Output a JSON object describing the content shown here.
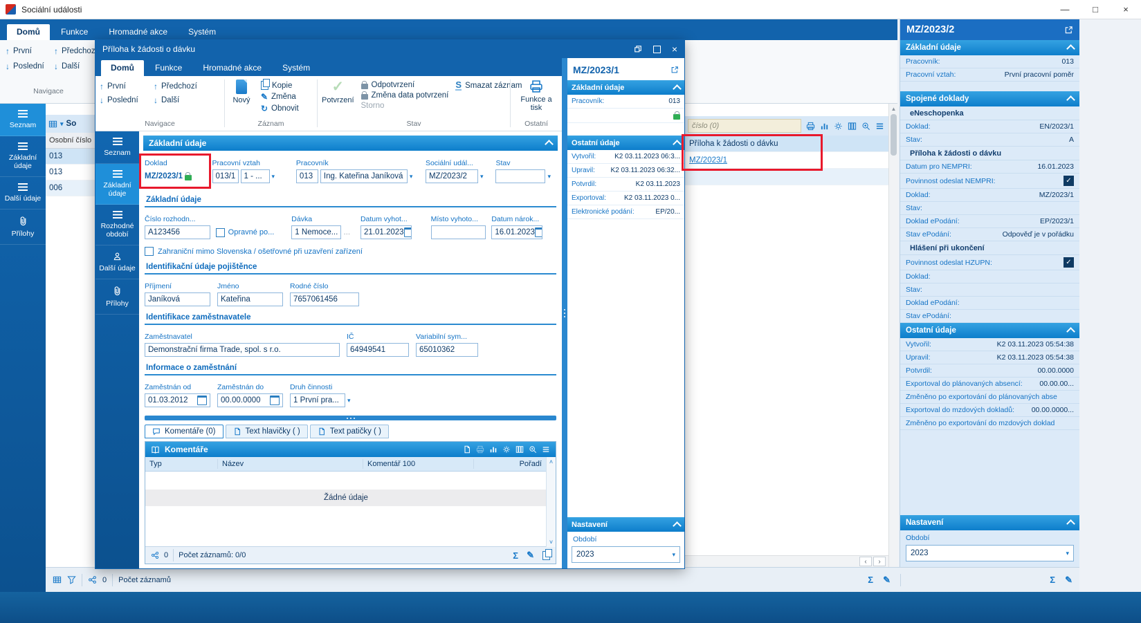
{
  "icons": {
    "minimize": "—",
    "maximize": "□",
    "close": "×",
    "arrow_up": "↑",
    "arrow_down": "↓",
    "chevron": "▾",
    "sum": "Σ",
    "pencil": "✎",
    "check": "✓",
    "refresh": "↻",
    "dots": "…",
    "scroll_up": "▲",
    "left": "‹",
    "right": "›",
    "chev_up_small": "˄",
    "chev_down_small": "˅",
    "s_delete": "S"
  },
  "window": {
    "title": "Sociální události"
  },
  "main_ribbon": {
    "tabs": [
      "Domů",
      "Funkce",
      "Hromadné akce",
      "Systém"
    ],
    "nav_first": "První",
    "nav_prev": "Předchozí",
    "nav_last": "Poslední",
    "nav_next": "Další",
    "group_nav": "Navigace"
  },
  "main_sidebar": {
    "items": [
      "Seznam",
      "Základní údaje",
      "Další údaje",
      "Přílohy"
    ]
  },
  "records_table": {
    "title": "So",
    "header": "Osobní číslo",
    "rows": [
      "013",
      "013",
      "006"
    ]
  },
  "bg_list": {
    "filter": "číslo (0)",
    "row_title": "Příloha k žádosti o dávku",
    "row_link": "MZ/2023/1"
  },
  "status_bar": {
    "share_count": "0",
    "records_label": "Počet záznamů"
  },
  "dialog": {
    "title": "Příloha k žádosti o dávku",
    "tabs": [
      "Domů",
      "Funkce",
      "Hromadné akce",
      "Systém"
    ],
    "ribbon": {
      "first": "První",
      "prev": "Předchozí",
      "last": "Poslední",
      "next": "Další",
      "group_nav": "Navigace",
      "new": "Nový",
      "copy": "Kopie",
      "change": "Změna",
      "refresh": "Obnovit",
      "group_rec": "Záznam",
      "confirm": "Potvrzení",
      "unconfirm": "Odpotvrzení",
      "change_confirm_date": "Změna data potvrzení",
      "cancel": "Storno",
      "delete": "Smazat záznam",
      "group_state": "Stav",
      "print": "Funkce a tisk",
      "group_other": "Ostatní"
    },
    "sidebar": [
      "Seznam",
      "Základní údaje",
      "Rozhodné období",
      "Další údaje",
      "Přílohy"
    ],
    "form": {
      "header": "Základní údaje",
      "doklad_label": "Doklad",
      "doklad_value": "MZ/2023/1",
      "pv_label": "Pracovní vztah",
      "pv_value": "013/1",
      "pv_value2": "1 - ...",
      "prac_label": "Pracovník",
      "prac_value": "013",
      "prac_value2": "Ing. Kateřina Janíková",
      "su_label": "Sociální udál...",
      "su_value": "MZ/2023/2",
      "stav_label": "Stav",
      "stav_value": "",
      "sec1": "Základní údaje",
      "cr_label": "Číslo rozhodn...",
      "cr_value": "A123456",
      "opr_label": "Opravné po...",
      "davka_label": "Dávka",
      "davka_value": "1 Nemoce...",
      "dv_label": "Datum vyhot...",
      "dv_value": "21.01.2023",
      "mv_label": "Místo vyhoto...",
      "mv_value": "",
      "dn_label": "Datum nárok...",
      "dn_value": "16.01.2023",
      "zahranicni": "Zahraniční mimo Slovenska / ošetřovné při uzavření zařízení",
      "sec2": "Identifikační údaje pojištěnce",
      "prijmeni_label": "Příjmení",
      "prijmeni_value": "Janíková",
      "jmeno_label": "Jméno",
      "jmeno_value": "Kateřina",
      "rc_label": "Rodné číslo",
      "rc_value": "7657061456",
      "sec3": "Identifikace zaměstnavatele",
      "zam_label": "Zaměstnavatel",
      "zam_value": "Demonstrační firma Trade, spol. s r.o.",
      "ic_label": "IČ",
      "ic_value": "64949541",
      "vs_label": "Variabilní sym...",
      "vs_value": "65010362",
      "sec4": "Informace o zaměstnání",
      "zo_label": "Zaměstnán od",
      "zo_value": "01.03.2012",
      "zd_label": "Zaměstnán do",
      "zd_value": "00.00.0000",
      "dc_label": "Druh činnosti",
      "dc_value": "1 První pra..."
    },
    "bottom_tabs": [
      "Komentáře (0)",
      "Text hlavičky ( )",
      "Text patičky ( )"
    ],
    "comments": {
      "header": "Komentáře",
      "columns": [
        "Typ",
        "Název",
        "Komentář 100",
        "Pořadí"
      ],
      "empty": "Žádné údaje",
      "count": "0",
      "records": "Počet záznamů: 0/0"
    }
  },
  "dialog_panel": {
    "title": "MZ/2023/1",
    "sec_zakladni": "Základní údaje",
    "sec_ostatni": "Ostatní údaje",
    "sec_nastaveni": "Nastavení",
    "zakladni_rows": [
      {
        "l": "Pracovník:",
        "v": "013"
      }
    ],
    "ostatni_rows": [
      {
        "l": "Vytvořil:",
        "v": "K2 03.11.2023 06:3..."
      },
      {
        "l": "Upravil:",
        "v": "K2 03.11.2023 06:32..."
      },
      {
        "l": "Potvrdil:",
        "v": "K2 03.11.2023"
      },
      {
        "l": "Exportoval:",
        "v": "K2 03.11.2023 0..."
      },
      {
        "l": "Elektronické podání:",
        "v": "EP/20..."
      }
    ],
    "obdobi_label": "Období",
    "obdobi_value": "2023"
  },
  "right_panel": {
    "title": "MZ/2023/2",
    "sec_zakladni": "Základní údaje",
    "sec_spojene": "Spojené doklady",
    "sec_ostatni": "Ostatní údaje",
    "sec_nastaveni": "Nastavení",
    "zakladni_rows": [
      {
        "l": "Pracovník:",
        "v": "013"
      },
      {
        "l": "Pracovní vztah:",
        "v": "První pracovní poměr"
      }
    ],
    "sub1": "eNeschopenka",
    "sub1_rows": [
      {
        "l": "Doklad:",
        "v": "EN/2023/1"
      },
      {
        "l": "Stav:",
        "v": "A"
      }
    ],
    "sub2": "Příloha k žádosti o dávku",
    "sub2_rows": [
      {
        "l": "Datum pro NEMPRI:",
        "v": "16.01.2023"
      },
      {
        "l": "Povinnost odeslat NEMPRI:",
        "v": ""
      },
      {
        "l": "Doklad:",
        "v": "MZ/2023/1"
      },
      {
        "l": "Stav:",
        "v": ""
      },
      {
        "l": "Doklad ePodání:",
        "v": "EP/2023/1"
      },
      {
        "l": "Stav ePodání:",
        "v": "Odpověď je v pořádku"
      }
    ],
    "sub3": "Hlášení při ukončení",
    "sub3_rows": [
      {
        "l": "Povinnost odeslat HZUPN:",
        "v": ""
      },
      {
        "l": "Doklad:",
        "v": ""
      },
      {
        "l": "Stav:",
        "v": ""
      },
      {
        "l": "Doklad ePodání:",
        "v": ""
      },
      {
        "l": "Stav ePodání:",
        "v": ""
      }
    ],
    "ostatni_rows": [
      {
        "l": "Vytvořil:",
        "v": "K2 03.11.2023 05:54:38"
      },
      {
        "l": "Upravil:",
        "v": "K2 03.11.2023 05:54:38"
      },
      {
        "l": "Potvrdil:",
        "v": "00.00.0000"
      },
      {
        "l": "Exportoval do plánovaných absencí:",
        "v": "00.00.00..."
      },
      {
        "l": "Změněno po exportování do plánovaných abse",
        "v": ""
      },
      {
        "l": "Exportoval do mzdových dokladů:",
        "v": "00.00.0000..."
      },
      {
        "l": "Změněno po exportování do mzdových doklad",
        "v": ""
      }
    ],
    "obdobi_label": "Období",
    "obdobi_value": "2023"
  }
}
